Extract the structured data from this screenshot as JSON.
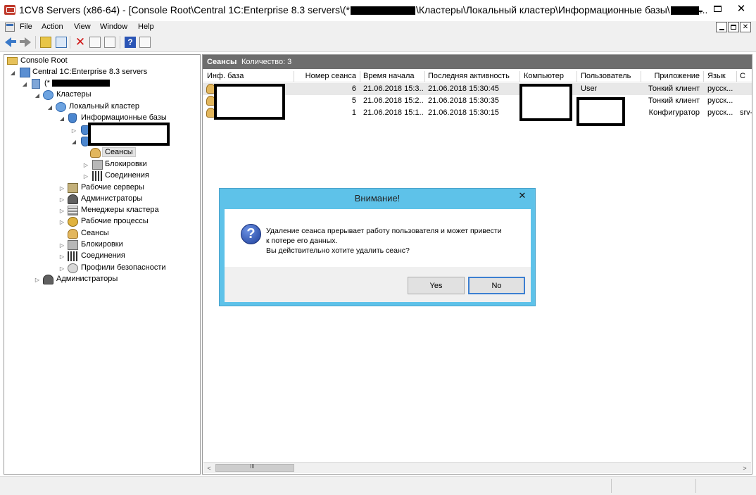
{
  "window": {
    "title_prefix": "1CV8 Servers (x86-64) - [Console Root\\Central 1C:Enterprise 8.3 servers\\(*",
    "title_middle": "\\Кластеры\\Локальный кластер\\Информационные базы\\",
    "title_suffix": "..."
  },
  "icons": {
    "app": "1c-servers-icon",
    "minimize": "minimize-icon",
    "maximize": "maximize-icon",
    "close": "close-icon"
  },
  "menu": {
    "items": [
      "File",
      "Action",
      "View",
      "Window",
      "Help"
    ]
  },
  "tree": {
    "root": "Console Root",
    "servers": "Central 1C:Enterprise 8.3 servers",
    "server_prefix": "(*",
    "clusters": "Кластеры",
    "local_cluster": "Локальный кластер",
    "infobases": "Информационные базы",
    "sessions": "Сеансы",
    "locks": "Блокировки",
    "connections": "Соединения",
    "work_servers": "Рабочие серверы",
    "administrators": "Администраторы",
    "cluster_managers": "Менеджеры кластера",
    "work_processes": "Рабочие процессы",
    "cluster_sessions": "Сеансы",
    "cluster_locks": "Блокировки",
    "cluster_connections": "Соединения",
    "security_profiles": "Профили безопасности",
    "server_administrators": "Администраторы"
  },
  "panel": {
    "title": "Сеансы",
    "count_label": "Количество: 3"
  },
  "table": {
    "columns": [
      "Инф. база",
      "Номер сеанса",
      "Время начала",
      "Последняя активность",
      "Компьютер",
      "Пользователь",
      "Приложение",
      "Язык",
      "С"
    ],
    "rows": [
      {
        "num": "6",
        "start": "21.06.2018 15:3...",
        "last": "21.06.2018 15:30:45",
        "user": "User",
        "app": "Тонкий клиент",
        "lang": "русск...",
        "extra": ""
      },
      {
        "num": "5",
        "start": "21.06.2018 15:2...",
        "last": "21.06.2018 15:30:35",
        "user": "",
        "app": "Тонкий клиент",
        "lang": "русск...",
        "extra": ""
      },
      {
        "num": "1",
        "start": "21.06.2018 15:1...",
        "last": "21.06.2018 15:30:15",
        "user": "",
        "app": "Конфигуратор",
        "lang": "русск...",
        "extra": "srv-"
      }
    ]
  },
  "dialog": {
    "title": "Внимание!",
    "message_line1": "Удаление сеанса прерывает работу пользователя и может привести",
    "message_line2": "к потере его данных.",
    "message_line3": "Вы действительно хотите удалить сеанс?",
    "yes": "Yes",
    "no": "No",
    "close_glyph": "✕"
  },
  "scroll": {
    "left_glyph": "<",
    "right_glyph": ">",
    "grip_glyph": "III"
  }
}
